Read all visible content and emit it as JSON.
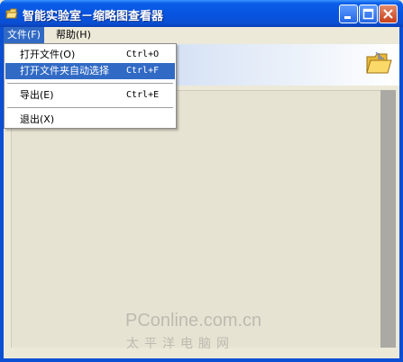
{
  "window": {
    "title": "智能实验室－缩略图查看器"
  },
  "menubar": [
    {
      "label": "文件(F)"
    },
    {
      "label": "帮助(H)"
    }
  ],
  "file_menu": [
    {
      "label": "打开文件(O)",
      "shortcut": "Ctrl+O",
      "highlighted": false
    },
    {
      "label": "打开文件夹自动选择",
      "shortcut": "Ctrl+F",
      "highlighted": true
    },
    {
      "label": "导出(E)",
      "shortcut": "Ctrl+E",
      "highlighted": false
    },
    {
      "label": "退出(X)",
      "shortcut": "",
      "highlighted": false
    }
  ],
  "watermark": {
    "line1": "PConline.com.cn",
    "line2": "太平洋电脑网"
  },
  "colors": {
    "titlebar": "#0a54e0",
    "menu_highlight": "#316ac5",
    "client": "#ece9d8"
  },
  "icons": [
    "app-icon",
    "minimize-icon",
    "maximize-icon",
    "close-icon",
    "open-folder-icon"
  ]
}
